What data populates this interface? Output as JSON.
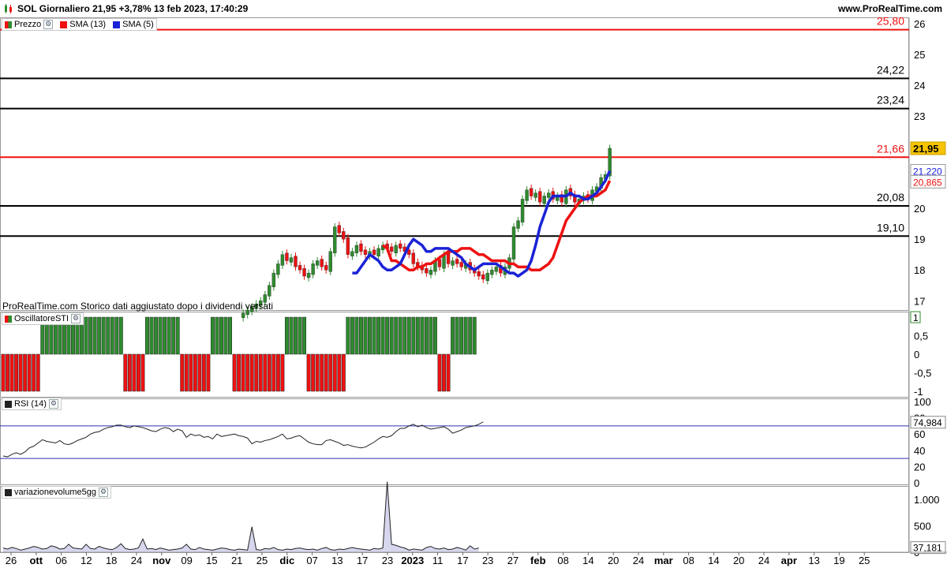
{
  "header": {
    "title": "SOL Giornaliero 21,95 +3,78% 13 feb 2023, 17:40:29",
    "site": "www.ProRealTime.com"
  },
  "note": "ProRealTime.com Storico dati aggiustato dopo i dividendi versati",
  "colors": {
    "up": "#2e8b2e",
    "down": "#e11",
    "sma13": "#e11",
    "sma5": "#1a22d6",
    "rsi": "#222",
    "vol": "#222",
    "volfill": "#d6d6ee"
  },
  "legends": {
    "price": [
      {
        "label": "Prezzo",
        "icon": "wrench-icon"
      },
      {
        "label": "SMA (13)",
        "color": "#e11"
      },
      {
        "label": "SMA (5)",
        "color": "#1a22d6"
      }
    ],
    "sti": "OscillatoreSTI",
    "rsi": "RSI (14)",
    "vol": "variazionevolume5gg"
  },
  "chart_data": [
    {
      "type": "candlestick",
      "panel": "price",
      "ylim": [
        16.7,
        26.2
      ],
      "yticks": [
        "26",
        "25",
        "24",
        "23",
        "22",
        "21",
        "20",
        "19",
        "18",
        "17"
      ],
      "hlines": [
        {
          "value": 25.8,
          "label": "25,80",
          "color": "red"
        },
        {
          "value": 24.22,
          "label": "24,22",
          "color": "black"
        },
        {
          "value": 23.24,
          "label": "23,24",
          "color": "black"
        },
        {
          "value": 21.66,
          "label": "21,66",
          "color": "red"
        },
        {
          "value": 20.08,
          "label": "20,08",
          "color": "black"
        },
        {
          "value": 19.1,
          "label": "19,10",
          "color": "black"
        }
      ],
      "tags": [
        {
          "value": 21.95,
          "label": "21,95",
          "style": "price"
        },
        {
          "value": 21.22,
          "label": "21,220",
          "style": "sma5"
        },
        {
          "value": 20.865,
          "label": "20,865",
          "style": "sma13"
        }
      ],
      "closes": [
        16.6,
        16.7,
        16.8,
        16.9,
        17.0,
        17.2,
        17.5,
        17.9,
        18.2,
        18.5,
        18.3,
        18.4,
        18.1,
        18.0,
        17.8,
        17.9,
        18.2,
        18.3,
        18.1,
        18.0,
        18.6,
        19.4,
        19.2,
        19.0,
        18.5,
        18.6,
        18.8,
        18.6,
        18.5,
        18.6,
        18.5,
        18.7,
        18.8,
        18.7,
        18.6,
        18.8,
        18.7,
        18.6,
        18.5,
        18.2,
        18.1,
        18.0,
        17.9,
        18.0,
        18.3,
        18.1,
        18.5,
        18.2,
        18.3,
        18.2,
        18.1,
        18.2,
        18.0,
        17.9,
        17.8,
        17.7,
        17.9,
        18.0,
        18.1,
        17.9,
        18.1,
        18.4,
        19.4,
        19.6,
        20.3,
        20.6,
        20.4,
        20.5,
        20.2,
        20.4,
        20.5,
        20.3,
        20.4,
        20.2,
        20.6,
        20.4,
        20.2,
        20.3,
        20.4,
        20.3,
        20.6,
        20.7,
        21.0,
        21.1,
        21.95
      ],
      "sma13": [
        18.8,
        18.7,
        18.3,
        18.3,
        18.2,
        18.1,
        18.0,
        18.0,
        18.1,
        18.1,
        18.2,
        18.2,
        18.3,
        18.4,
        18.5,
        18.6,
        18.6,
        18.6,
        18.7,
        18.7,
        18.7,
        18.6,
        18.5,
        18.5,
        18.4,
        18.3,
        18.3,
        18.3,
        18.3,
        18.2,
        18.2,
        18.1,
        18.1,
        18.1,
        18.0,
        18.0,
        18.0,
        18.1,
        18.2,
        18.4,
        18.8,
        19.2,
        19.6,
        19.8,
        20.0,
        20.2,
        20.3,
        20.4,
        20.4,
        20.4,
        20.5,
        20.6,
        20.9
      ],
      "sma13_start_bar": 32,
      "sma5": [
        17.9,
        17.9,
        18.1,
        18.3,
        18.5,
        18.4,
        18.3,
        18.1,
        18.0,
        18.0,
        18.1,
        18.2,
        18.5,
        18.8,
        19.0,
        18.9,
        18.8,
        18.6,
        18.6,
        18.7,
        18.7,
        18.7,
        18.7,
        18.6,
        18.5,
        18.4,
        18.2,
        18.1,
        18.0,
        18.1,
        18.2,
        18.2,
        18.2,
        18.2,
        18.1,
        18.0,
        17.9,
        17.9,
        17.8,
        17.9,
        18.0,
        18.3,
        18.8,
        19.4,
        19.8,
        20.2,
        20.4,
        20.4,
        20.4,
        20.4,
        20.5,
        20.4,
        20.4,
        20.3,
        20.3,
        20.4,
        20.5,
        20.7,
        20.9,
        21.22
      ],
      "sma5_start_bar": 25
    },
    {
      "type": "bar",
      "panel": "OscillatoreSTI",
      "ylim": [
        -1.15,
        1.15
      ],
      "yticks": [
        "1",
        "0,5",
        "0",
        "-0,5",
        "-1"
      ],
      "values": [
        -1,
        -1,
        -1,
        -1,
        -1,
        -1,
        -1,
        -1,
        -1,
        1,
        1,
        1,
        1,
        1,
        1,
        1,
        1,
        1,
        1,
        1,
        1,
        1,
        1,
        1,
        1,
        1,
        1,
        1,
        -1,
        -1,
        -1,
        -1,
        -1,
        1,
        1,
        1,
        1,
        1,
        1,
        1,
        1,
        -1,
        -1,
        -1,
        -1,
        -1,
        -1,
        -1,
        1,
        1,
        1,
        1,
        1,
        -1,
        -1,
        -1,
        -1,
        -1,
        -1,
        -1,
        -1,
        -1,
        -1,
        -1,
        -1,
        1,
        1,
        1,
        1,
        1,
        -1,
        -1,
        -1,
        -1,
        -1,
        -1,
        -1,
        -1,
        -1,
        1,
        1,
        1,
        1,
        1,
        1,
        1,
        1,
        1,
        1,
        1,
        1,
        1,
        1,
        1,
        1,
        1,
        1,
        1,
        1,
        1,
        -1,
        -1,
        -1,
        1,
        1,
        1,
        1,
        1,
        1
      ]
    },
    {
      "type": "line",
      "panel": "RSI (14)",
      "ylim": [
        0,
        100
      ],
      "yticks": [
        "100",
        "80",
        "60",
        "40",
        "20",
        "0"
      ],
      "hlines": [
        70,
        30
      ],
      "last": "74,984",
      "values": [
        33,
        32,
        35,
        37,
        35,
        38,
        43,
        45,
        49,
        53,
        51,
        50,
        49,
        52,
        48,
        47,
        49,
        52,
        54,
        56,
        60,
        62,
        63,
        66,
        68,
        69,
        71,
        71,
        69,
        68,
        70,
        69,
        68,
        66,
        64,
        63,
        66,
        68,
        67,
        63,
        66,
        64,
        56,
        60,
        58,
        59,
        56,
        57,
        54,
        60,
        57,
        58,
        59,
        60,
        58,
        57,
        55,
        48,
        51,
        50,
        52,
        53,
        55,
        57,
        60,
        54,
        55,
        57,
        58,
        54,
        50,
        48,
        47,
        47,
        52,
        53,
        51,
        49,
        46,
        47,
        45,
        44,
        43,
        44,
        47,
        50,
        54,
        57,
        56,
        58,
        63,
        67,
        67,
        70,
        72,
        69,
        71,
        68,
        66,
        67,
        68,
        69,
        66,
        61,
        63,
        65,
        68,
        69,
        70,
        72,
        75
      ]
    },
    {
      "type": "area",
      "panel": "variazionevolume5gg",
      "ylim": [
        0,
        1250
      ],
      "yticks": [
        "1.000",
        "500",
        "0"
      ],
      "last": "37,181",
      "values": [
        80,
        60,
        90,
        70,
        40,
        60,
        80,
        110,
        90,
        60,
        70,
        120,
        100,
        60,
        70,
        150,
        80,
        70,
        60,
        150,
        70,
        60,
        110,
        80,
        60,
        50,
        90,
        160,
        70,
        50,
        60,
        80,
        250,
        60,
        70,
        50,
        80,
        60,
        40,
        50,
        60,
        80,
        150,
        60,
        50,
        90,
        60,
        50,
        40,
        60,
        80,
        70,
        50,
        40,
        60,
        50,
        40,
        480,
        50,
        40,
        70,
        60,
        90,
        50,
        40,
        60,
        50,
        70,
        80,
        60,
        50,
        60,
        40,
        70,
        90,
        50,
        40,
        60,
        50,
        70,
        90,
        70,
        60,
        50,
        40,
        70,
        60,
        80,
        1330,
        150,
        130,
        100,
        80,
        40,
        60,
        50,
        40,
        90,
        110,
        70,
        60,
        80,
        50,
        60,
        90,
        70,
        40,
        120,
        60,
        80
      ]
    }
  ],
  "xaxis": {
    "labels": [
      {
        "t": "26",
        "b": false
      },
      {
        "t": "ott",
        "b": true
      },
      {
        "t": "06",
        "b": false
      },
      {
        "t": "12",
        "b": false
      },
      {
        "t": "18",
        "b": false
      },
      {
        "t": "24",
        "b": false
      },
      {
        "t": "nov",
        "b": true
      },
      {
        "t": "09",
        "b": false
      },
      {
        "t": "15",
        "b": false
      },
      {
        "t": "21",
        "b": false
      },
      {
        "t": "25",
        "b": false
      },
      {
        "t": "dic",
        "b": true
      },
      {
        "t": "07",
        "b": false
      },
      {
        "t": "13",
        "b": false
      },
      {
        "t": "17",
        "b": false
      },
      {
        "t": "23",
        "b": false
      },
      {
        "t": "2023",
        "b": true
      },
      {
        "t": "11",
        "b": false
      },
      {
        "t": "17",
        "b": false
      },
      {
        "t": "23",
        "b": false
      },
      {
        "t": "27",
        "b": false
      },
      {
        "t": "feb",
        "b": true
      },
      {
        "t": "08",
        "b": false
      },
      {
        "t": "14",
        "b": false
      },
      {
        "t": "20",
        "b": false
      },
      {
        "t": "24",
        "b": false
      },
      {
        "t": "mar",
        "b": true
      },
      {
        "t": "08",
        "b": false
      },
      {
        "t": "14",
        "b": false
      },
      {
        "t": "20",
        "b": false
      },
      {
        "t": "24",
        "b": false
      },
      {
        "t": "apr",
        "b": true
      },
      {
        "t": "13",
        "b": false
      },
      {
        "t": "19",
        "b": false
      },
      {
        "t": "25",
        "b": false
      }
    ]
  }
}
